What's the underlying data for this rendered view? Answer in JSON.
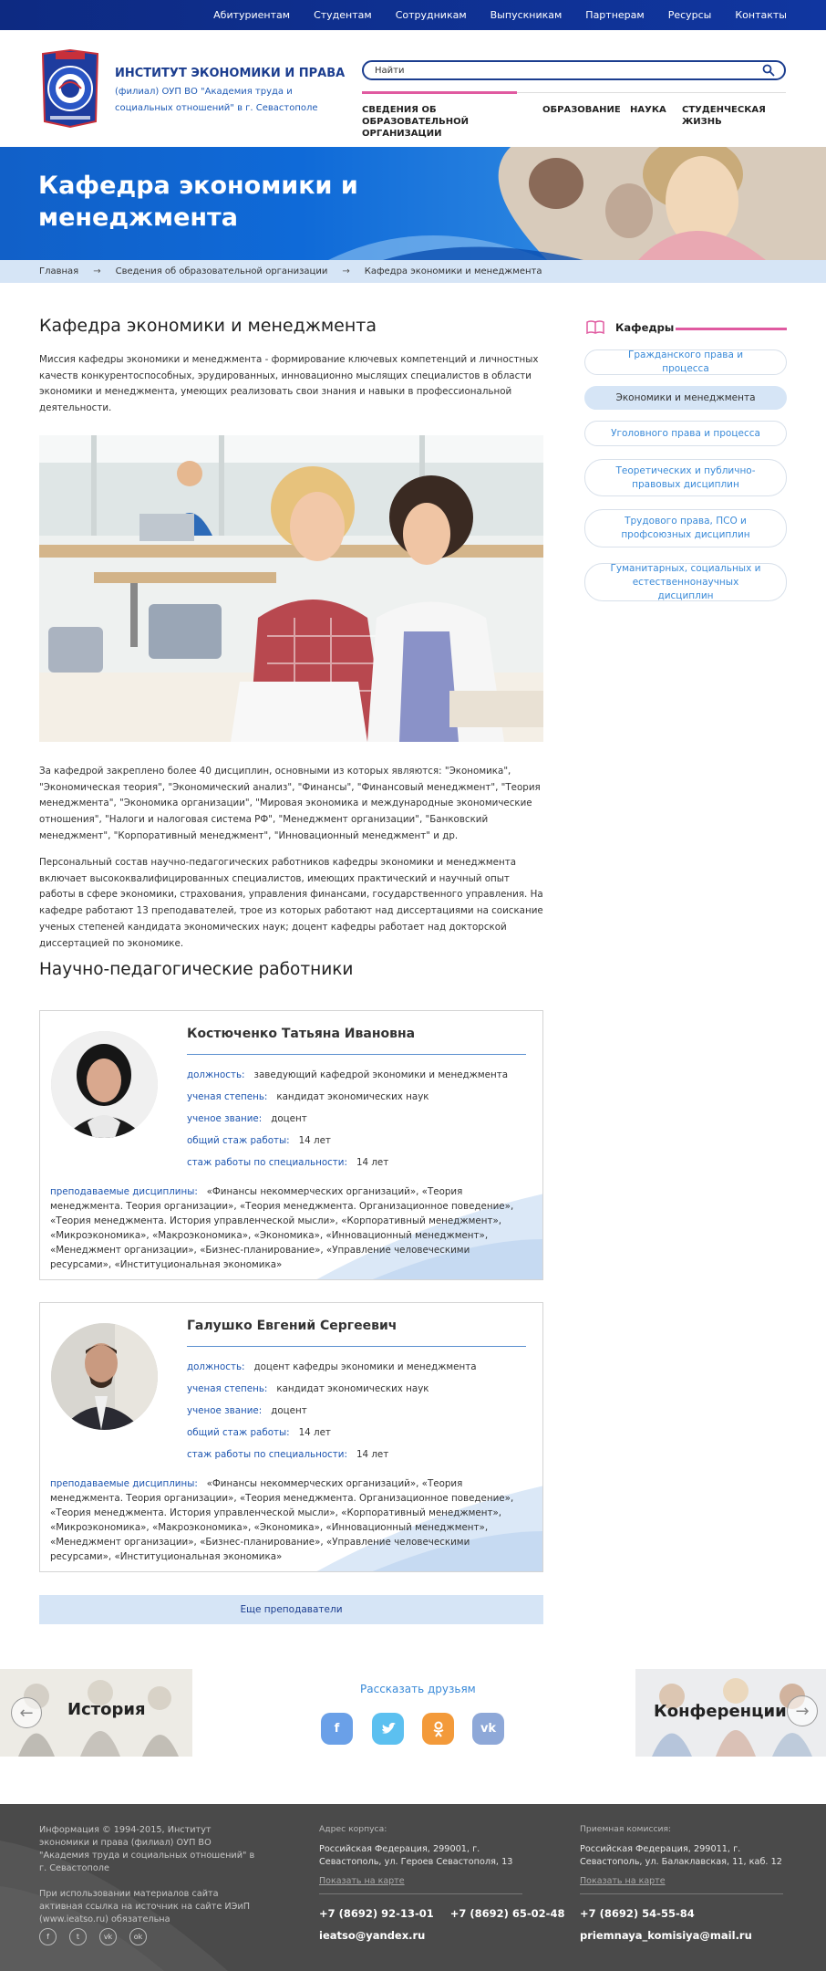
{
  "topnav": [
    "Абитуриентам",
    "Студентам",
    "Сотрудникам",
    "Выпускникам",
    "Партнерам",
    "Ресурсы",
    "Контакты"
  ],
  "header": {
    "title": "ИНСТИТУТ ЭКОНОМИКИ И ПРАВА",
    "subtitle": "(филиал) ОУП ВО \"Академия труда и социальных отношений\" в г. Севастополе",
    "search_placeholder": "Найти",
    "nav": [
      "СВЕДЕНИЯ ОБ ОБРАЗОВАТЕЛЬНОЙ ОРГАНИЗАЦИИ",
      "ОБРАЗОВАНИЕ",
      "НАУКА",
      "СТУДЕНЧЕСКАЯ ЖИЗНЬ"
    ]
  },
  "hero": {
    "title": "Кафедра экономики и менеджмента"
  },
  "breadcrumb": [
    "Главная",
    "Сведения об образовательной организации",
    "Кафедра экономики и менеджмента"
  ],
  "main": {
    "heading": "Кафедра экономики и менеджмента",
    "intro": "Миссия кафедры экономики и менеджмента - формирование ключевых компетенций и личностных качеств конкурентоспособных, эрудированных, инновационно мыслящих специалистов в области экономики и менеджмента, умеющих реализовать свои знания и навыки в профессиональной деятельности.",
    "para2": "За кафедрой закреплено более 40 дисциплин, основными из которых являются: \"Экономика\", \"Экономическая теория\", \"Экономический анализ\", \"Финансы\", \"Финансовый менеджмент\", \"Теория менеджмента\", \"Экономика организации\", \"Мировая экономика и международные экономические отношения\", \"Налоги и налоговая система РФ\", \"Менеджмент организации\", \"Банковский менеджмент\", \"Корпоративный менеджмент\", \"Инновационный менеджмент\" и др.",
    "para3": "Персональный состав научно-педагогических работников кафедры экономики и менеджмента включает высококвалифицированных специалистов, имеющих практический и научный опыт работы в сфере экономики, страхования, управления финансами, государственного управления. На кафедре работают 13 преподавателей, трое из которых работают над диссертациями на соискание ученых степеней кандидата экономических наук; доцент кафедры работает над докторской диссертацией по экономике.",
    "staff_heading": "Научно-педагогические работники",
    "more_button": "Еще преподаватели"
  },
  "labels": {
    "position": "должность:",
    "degree": "ученая степень:",
    "rank": "ученое звание:",
    "total_exp": "общий стаж работы:",
    "spec_exp": "стаж работы по специальности:",
    "disciplines": "преподаваемые дисциплины:"
  },
  "staff": [
    {
      "name": "Костюченко Татьяна Ивановна",
      "position": "заведующий кафедрой экономики и менеджмента",
      "degree": "кандидат экономических наук",
      "rank": "доцент",
      "total_exp": "14 лет",
      "spec_exp": "14 лет",
      "disciplines": "«Финансы некоммерческих организаций», «Теория менеджмента. Теория организации», «Теория менеджмента. Организационное поведение», «Теория менеджмента. История управленческой мысли», «Корпоративный менеджмент», «Микроэкономика», «Макроэкономика», «Экономика», «Инновационный менеджмент», «Менеджмент организации», «Бизнес-планирование», «Управление человеческими ресурсами», «Институциональная экономика»"
    },
    {
      "name": "Галушко Евгений Сергеевич",
      "position": "доцент кафедры экономики и менеджмента",
      "degree": "кандидат экономических наук",
      "rank": "доцент",
      "total_exp": "14 лет",
      "spec_exp": "14 лет",
      "disciplines": "«Финансы некоммерческих организаций», «Теория менеджмента. Теория организации», «Теория менеджмента. Организационное поведение», «Теория менеджмента. История управленческой мысли», «Корпоративный менеджмент», «Микроэкономика», «Макроэкономика», «Экономика», «Инновационный менеджмент», «Менеджмент организации», «Бизнес-планирование», «Управление человеческими ресурсами», «Институциональная экономика»"
    }
  ],
  "sidebar": {
    "title": "Кафедры",
    "items": [
      {
        "label": "Гражданского права и процесса",
        "active": false
      },
      {
        "label": "Экономики и менеджмента",
        "active": true
      },
      {
        "label": "Уголовного права и процесса",
        "active": false
      },
      {
        "label": "Теоретических и публично-правовых дисциплин",
        "active": false
      },
      {
        "label": "Трудового права, ПСО и профсоюзных дисциплин",
        "active": false
      },
      {
        "label": "Гуманитарных, социальных и естественнонаучных дисциплин",
        "active": false
      }
    ]
  },
  "bottom": {
    "left_tile": "История",
    "right_tile": "Конференции",
    "share_title": "Рассказать друзьям",
    "social": [
      "facebook-icon",
      "twitter-icon",
      "odnoklassniki-icon",
      "vk-icon"
    ]
  },
  "footer": {
    "copyright": "Информация © 1994-2015, Институт экономики и права (филиал) ОУП ВО \"Академия труда и социальных отношений\" в г. Севастополе",
    "notice": "При использовании материалов сайта активная ссылка на источник на сайте ИЭиП (www.ieatso.ru) обязательна",
    "campus_label": "Адрес корпуса:",
    "campus_address": "Российская Федерация, 299001, г. Севастополь, ул. Героев Севастополя, 13",
    "map_link": "Показать на карте",
    "campus_phone1": "+7 (8692) 92-13-01",
    "campus_phone2": "+7 (8692) 65-02-48",
    "campus_email": "ieatso@yandex.ru",
    "admission_label": "Приемная комиссия:",
    "admission_address": "Российская Федерация, 299011, г. Севастополь, ул. Балаклавская, 11, каб. 12",
    "admission_phone": "+7 (8692) 54-55-84",
    "admission_email": "priemnaya_komisiya@mail.ru"
  },
  "colors": {
    "navy": "#0d2a82",
    "accent_pink": "#e05aa0",
    "link_blue": "#3a8ad8",
    "light_blue": "#d6e5f6"
  }
}
